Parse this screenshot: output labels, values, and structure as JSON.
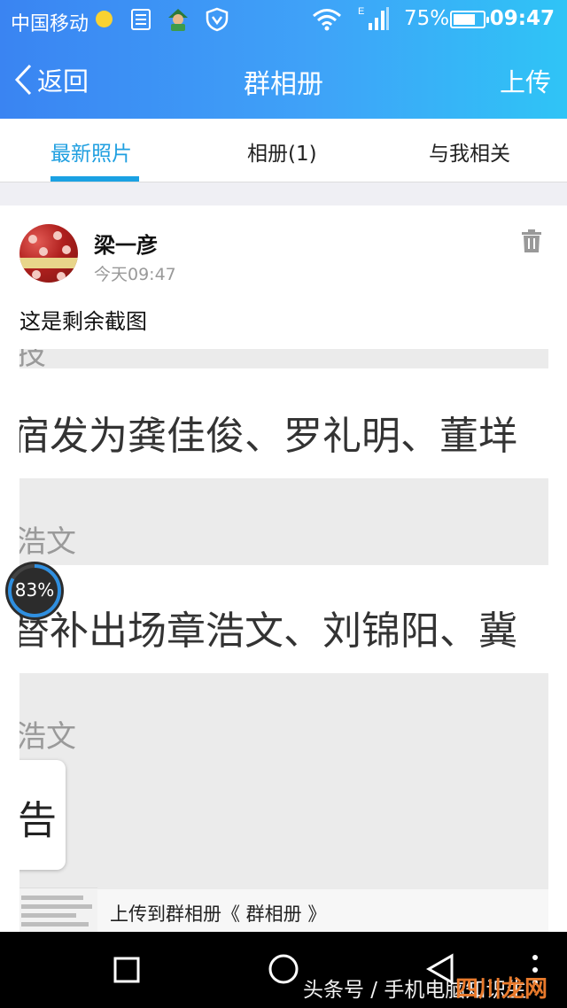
{
  "status_bar": {
    "carrier": "中国移动",
    "network": "E",
    "battery_percent": "75%",
    "battery_level": 0.75,
    "time": "09:47",
    "icons": [
      "notification-dot-icon",
      "sim-card-icon",
      "app-character-icon",
      "shield-icon",
      "wifi-icon",
      "signal-icon",
      "battery-icon"
    ]
  },
  "nav": {
    "back_label": "返回",
    "title": "群相册",
    "upload_label": "上传"
  },
  "tabs": [
    {
      "label": "最新照片",
      "active": true
    },
    {
      "label": "相册(1)",
      "active": false
    },
    {
      "label": "与我相关",
      "active": false
    }
  ],
  "post": {
    "author": "梁一彦",
    "time": "今天09:47",
    "caption": "这是剩余截图",
    "delete_icon": "trash-icon",
    "image_texts": {
      "line1": "宿发为龚佳俊、罗礼明、董垟",
      "line2": "浩文",
      "line3": "替补出场章浩文、刘锦阳、冀",
      "line4": "浩文",
      "card": "告",
      "top_fragment": "技"
    },
    "upload_note": "上传到群相册《 群相册 》"
  },
  "floating_widget": {
    "label": "83%",
    "level": 0.83
  },
  "system_nav": {
    "icons": [
      "recent-apps-icon",
      "home-icon",
      "back-triangle-icon",
      "more-dots-icon"
    ]
  },
  "watermark": {
    "text": "头条号 / 手机电脑知识生",
    "text2": "四川龙网"
  },
  "colors": {
    "accent": "#1f9fe0",
    "header_start": "#3a84f2",
    "header_end": "#2fc4f6"
  }
}
